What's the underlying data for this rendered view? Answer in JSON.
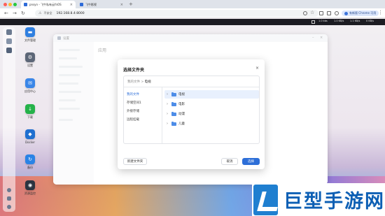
{
  "browser": {
    "tabs": [
      {
        "title": "pnsyn - 飞牛私有云fnOS",
        "active": true
      },
      {
        "title": "飞牛影视",
        "active": false
      }
    ],
    "new_tab": "+",
    "security_label": "不安全",
    "url": "192.168.8.4:8000",
    "profile_label": "有新版 Chrome 可用",
    "nav": {
      "back": "←",
      "forward": "→",
      "reload": "↻"
    }
  },
  "statusbar": {
    "items": [
      "1.0 kbs",
      "1.0 KB/s",
      "1.1 KB/s",
      "0 KB/s"
    ]
  },
  "desktop": {
    "apps": [
      {
        "label": "文件管理",
        "color": "#2f7fe0"
      },
      {
        "label": "设置",
        "color": "#5c6677"
      },
      {
        "label": "应用中心",
        "color": "#3a86e8"
      },
      {
        "label": "下载",
        "color": "#25b24a"
      },
      {
        "label": "Docker",
        "color": "#1f6fd0"
      },
      {
        "label": "备份",
        "color": "#2a83e6"
      },
      {
        "label": "资源监控",
        "color": "#2b3440"
      }
    ]
  },
  "settings": {
    "title": "设置",
    "heading": "应用"
  },
  "dialog": {
    "title": "选择文件夹",
    "close": "×",
    "breadcrumb": {
      "root": "我的文件",
      "sep": ">",
      "current": "电视"
    },
    "sidebar": [
      {
        "label": "我的文件",
        "selected": true
      },
      {
        "label": "存储空间1",
        "selected": false
      },
      {
        "label": "外接存储",
        "selected": false
      },
      {
        "label": "远程挂载",
        "selected": false
      }
    ],
    "folders": [
      {
        "name": "电视",
        "selected": true
      },
      {
        "name": "电影",
        "selected": false
      },
      {
        "name": "动漫",
        "selected": false
      },
      {
        "name": "儿童",
        "selected": false
      }
    ],
    "new_folder": "新建文件夹",
    "cancel": "取消",
    "confirm": "选择"
  },
  "watermark": {
    "text": "巨型手游网"
  }
}
